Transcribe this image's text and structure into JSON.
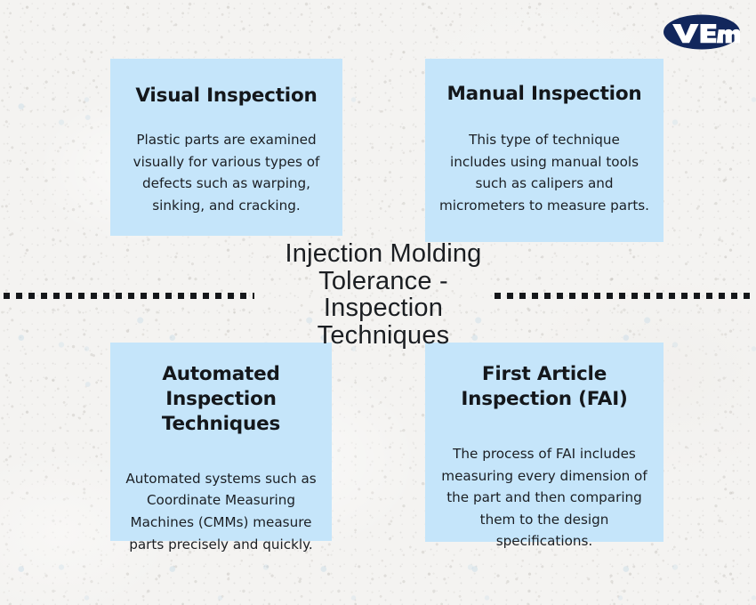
{
  "theme": {
    "background_color": "#f3f2f0",
    "card_color": "#c5e5fa",
    "text_color": "#15181c",
    "logo_color": "#12275c",
    "divider_color": "#15171a"
  },
  "brand": {
    "logo_text": "VEM",
    "logo_icon": "vem-oval-logo"
  },
  "center": {
    "title": "Injection Molding\nTolerance -\nInspection\nTechniques"
  },
  "cards": [
    {
      "id": "visual-inspection",
      "title": "Visual Inspection",
      "body": "Plastic parts are examined visually for various types of defects such as warping, sinking, and cracking."
    },
    {
      "id": "manual-inspection",
      "title": "Manual Inspection",
      "body": "This type of technique includes using manual tools such as calipers and micrometers to measure parts."
    },
    {
      "id": "automated-inspection",
      "title": "Automated Inspection Techniques",
      "body": "Automated systems such as Coordinate Measuring Machines (CMMs) measure parts precisely and quickly."
    },
    {
      "id": "first-article-inspection",
      "title": "First Article Inspection (FAI)",
      "body": "The process of FAI includes measuring every dimension of the part and then comparing them to the design specifications."
    }
  ]
}
